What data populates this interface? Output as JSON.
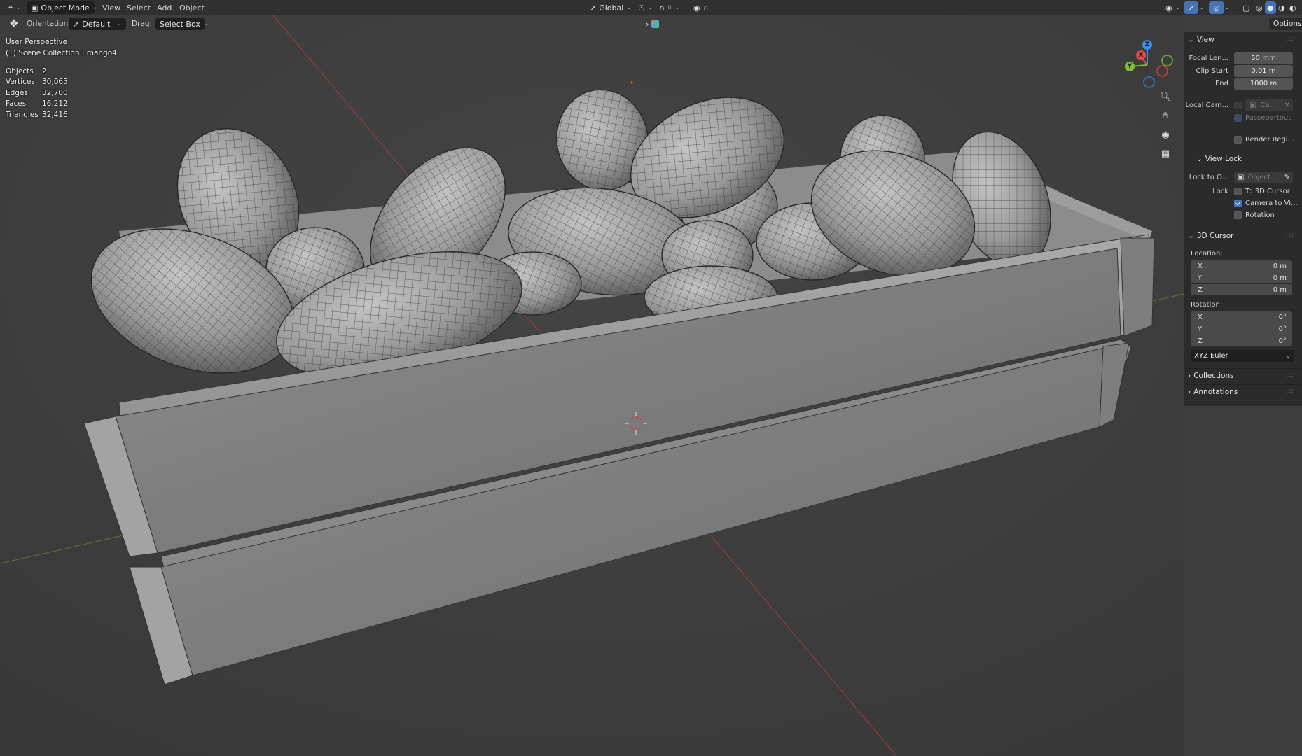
{
  "header": {
    "mode": "Object Mode",
    "menus": [
      "View",
      "Select",
      "Add",
      "Object"
    ],
    "transform_orientation": "Global",
    "options_label": "Options"
  },
  "tool_settings": {
    "orientation_label": "Orientation:",
    "orientation_value": "Default",
    "drag_label": "Drag:",
    "drag_value": "Select Box"
  },
  "viewport": {
    "view_name": "User Perspective",
    "collection": "(1) Scene Collection | mango4",
    "stats": [
      {
        "label": "Objects",
        "value": "2"
      },
      {
        "label": "Vertices",
        "value": "30,065"
      },
      {
        "label": "Edges",
        "value": "32,700"
      },
      {
        "label": "Faces",
        "value": "16,212"
      },
      {
        "label": "Triangles",
        "value": "32,416"
      }
    ],
    "gizmo_axes": [
      "Z",
      "X",
      "Y"
    ]
  },
  "sidebar": {
    "view_panel": {
      "title": "View",
      "focal_length_label": "Focal Len...",
      "focal_length_value": "50 mm",
      "clip_start_label": "Clip Start",
      "clip_start_value": "0.01 m",
      "end_label": "End",
      "end_value": "1000 m",
      "local_camera_label": "Local Cam...",
      "local_camera_value": "Ca...",
      "passepartout_label": "Passepartout",
      "render_region_label": "Render Regi..."
    },
    "view_lock_panel": {
      "title": "View Lock",
      "lock_to_object_label": "Lock to O...",
      "lock_to_object_placeholder": "Object",
      "lock_label": "Lock",
      "to_3d_cursor_label": "To 3D Cursor",
      "camera_to_view_label": "Camera to Vi...",
      "camera_to_view_checked": true,
      "rotation_label": "Rotation"
    },
    "cursor_panel": {
      "title": "3D Cursor",
      "location_label": "Location:",
      "location": [
        {
          "axis": "X",
          "value": "0 m"
        },
        {
          "axis": "Y",
          "value": "0 m"
        },
        {
          "axis": "Z",
          "value": "0 m"
        }
      ],
      "rotation_label": "Rotation:",
      "rotation": [
        {
          "axis": "X",
          "value": "0°"
        },
        {
          "axis": "Y",
          "value": "0°"
        },
        {
          "axis": "Z",
          "value": "0°"
        }
      ],
      "rotation_mode": "XYZ Euler"
    },
    "collapsed_panels": [
      "Collections",
      "Annotations"
    ]
  },
  "colors": {
    "accent": "#4772b3",
    "viewport_bg": "#3d3d3d",
    "panel_bg": "#2b2b2b",
    "axis_x": "#e24b4b",
    "axis_y": "#7cc035",
    "axis_z": "#3d8ee8"
  }
}
